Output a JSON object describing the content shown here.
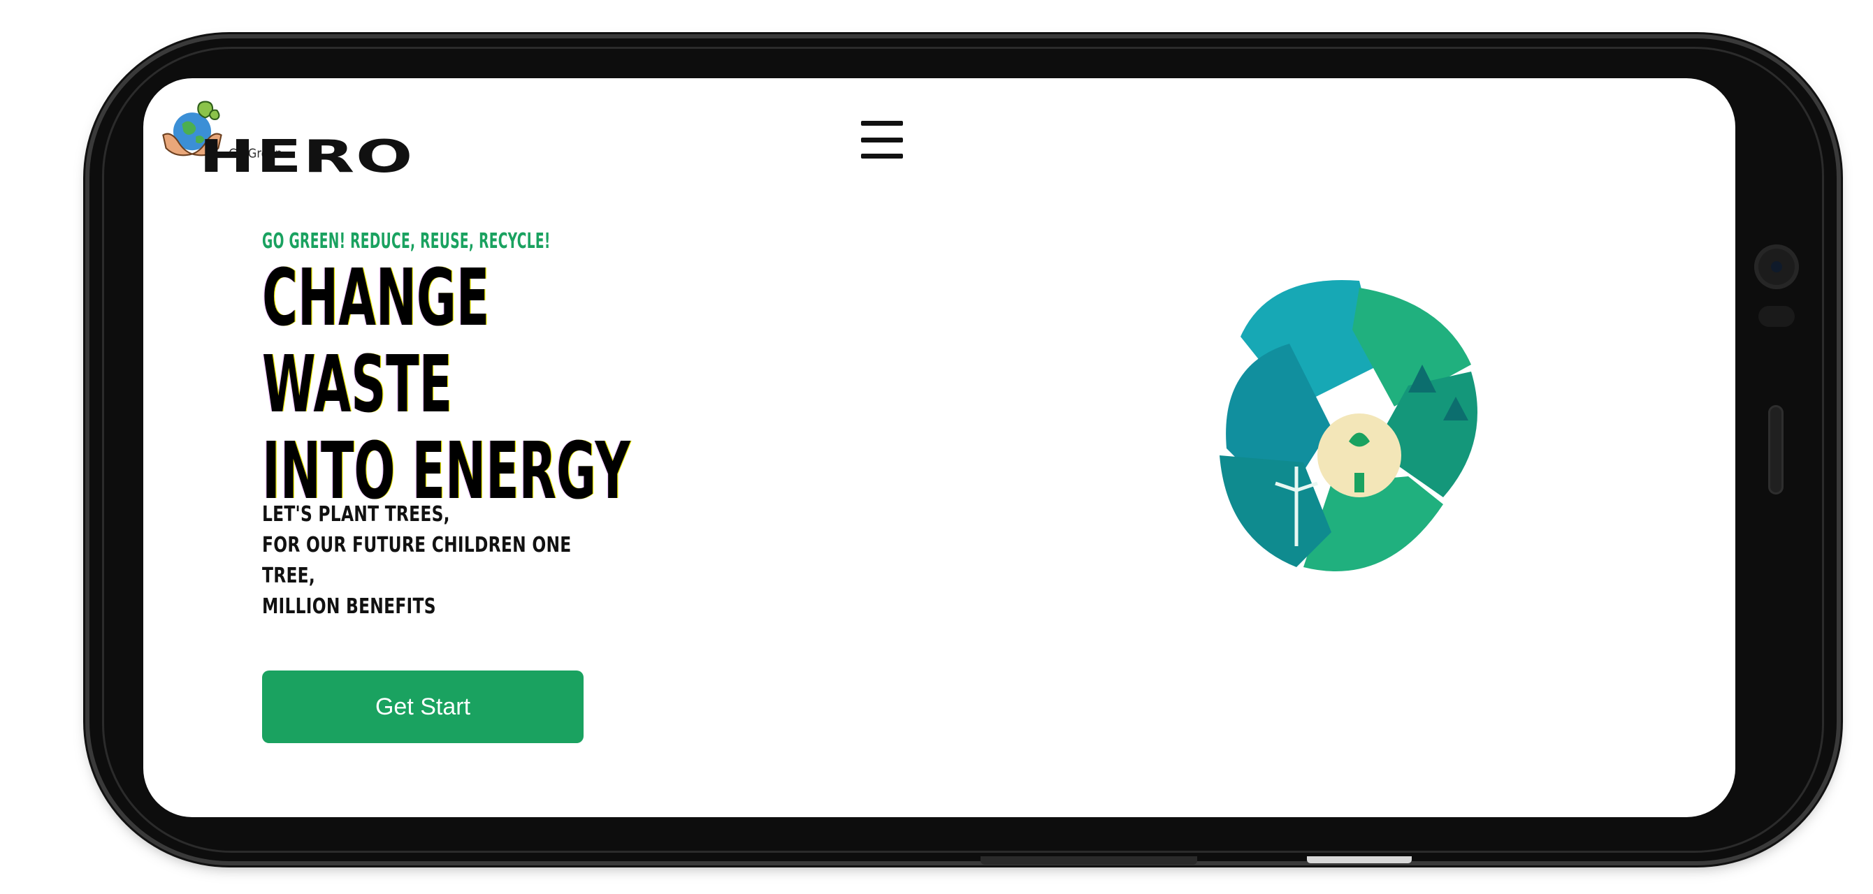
{
  "brand": {
    "small": "Go Green",
    "name": "HERO"
  },
  "hero": {
    "tagline": "GO GREEN! REDUCE, REUSE, RECYCLE!",
    "headline": [
      "CHANGE",
      "WASTE",
      "INTO ENERGY"
    ],
    "description": [
      "LET'S PLANT TREES,",
      "FOR  OUR  FUTURE  CHILDREN  ONE",
      "TREE,",
      "MILLION BENEFITS"
    ],
    "cta_label": "Get Start"
  },
  "icons": {
    "menu": "hamburger-menu-icon",
    "logo": "earth-in-hands-logo",
    "illustration": "recycle-energy-illustration"
  },
  "colors": {
    "accent": "#1aa260",
    "teal": "#17a8b5",
    "green_light": "#20b07e",
    "frame": "#0d0d0d"
  }
}
